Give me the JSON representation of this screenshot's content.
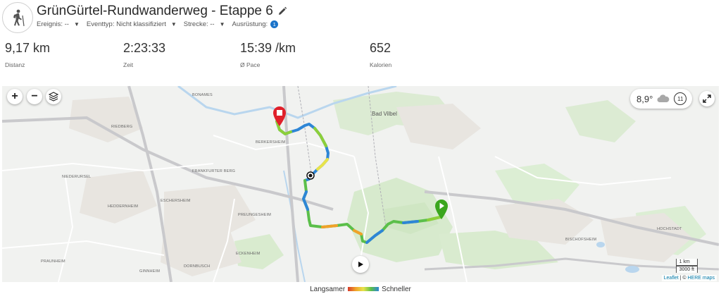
{
  "header": {
    "title": "GrünGürtel-Rundwanderweg - Etappe 6",
    "meta": [
      {
        "label": "Ereignis: --"
      },
      {
        "label": "Eventtyp: Nicht klassifiziert"
      },
      {
        "label": "Strecke: --"
      },
      {
        "label": "Ausrüstung:"
      }
    ],
    "gear_count": "1"
  },
  "stats": [
    {
      "value": "9,17 km",
      "label": "Distanz"
    },
    {
      "value": "2:23:33",
      "label": "Zeit"
    },
    {
      "value": "15:39 /km",
      "label": "Ø Pace"
    },
    {
      "value": "652",
      "label": "Kalorien"
    }
  ],
  "map": {
    "controls": {
      "zoom_in": "+",
      "zoom_out": "−"
    },
    "weather": {
      "temp": "8,9°",
      "wind": "11"
    },
    "scale": {
      "metric": "1 km",
      "imperial": "3000 ft"
    },
    "attribution": {
      "leaflet": "Leaflet",
      "separator": " | © ",
      "provider": "HERE maps"
    },
    "places": {
      "bad_vilbel": "Bad Vilbel",
      "berkersheim": "BERKERSHEIM",
      "heddernheim": "HEDDERNHEIM",
      "eschersheim": "ESCHERSHEIM",
      "preungesheim": "PREUNGESHEIM",
      "eckenheim": "ECKENHEIM",
      "ginnheim": "GINNHEIM",
      "dornbusch": "DORNBUSCH",
      "bischofsheim": "BISCHOFSHEIM",
      "hochstadt": "HOCHSTADT",
      "praunheim": "PRAUNHEIM",
      "riedberg": "RIEDBERG",
      "niederursel": "NIEDERURSEL",
      "frankfurter_berg": "FRANKFURTER BERG",
      "bonames": "BONAMES"
    }
  },
  "legend": {
    "slower": "Langsamer",
    "faster": "Schneller"
  },
  "colors": {
    "accent": "#1a73c9",
    "start": "#3aa61d",
    "end": "#e0202a",
    "route_fast": "#2e86d6",
    "route_mid": "#8ccf3a",
    "route_slow": "#f0a22a"
  }
}
